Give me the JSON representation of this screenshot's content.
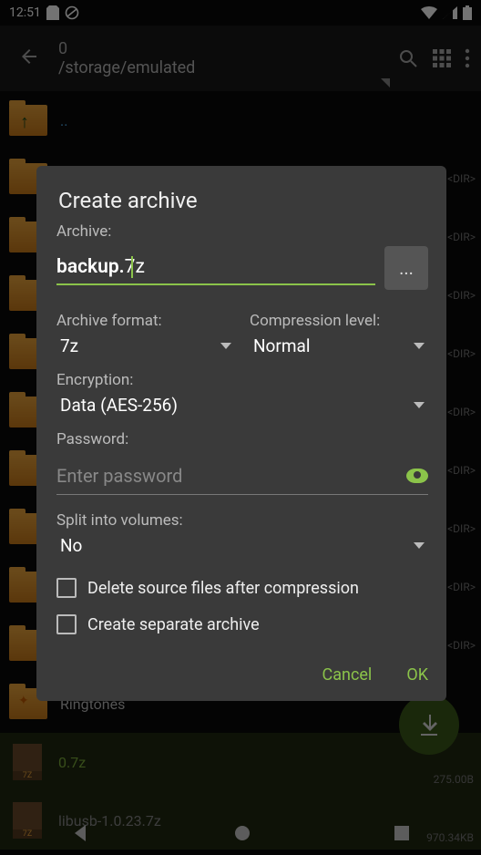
{
  "statusbar": {
    "time": "12:51"
  },
  "appbar": {
    "count": "0",
    "path": "/storage/emulated"
  },
  "fileList": {
    "upDots": "..",
    "ringtones": "Ringtones",
    "archive1": "0.7z",
    "archive1size": "275.00B",
    "archive2": "libusb-1.0.23.7z",
    "archive2size": "970.34KB",
    "dirTag": "<DIR>"
  },
  "dialog": {
    "title": "Create archive",
    "archiveLabel": "Archive:",
    "nameBase": "backup.",
    "nameExt": "7z",
    "browse": "...",
    "formatLabel": "Archive format:",
    "formatValue": "7z",
    "compLabel": "Compression level:",
    "compValue": "Normal",
    "encLabel": "Encryption:",
    "encValue": "Data (AES-256)",
    "pwdLabel": "Password:",
    "pwdPlaceholder": "Enter password",
    "splitLabel": "Split into volumes:",
    "splitValue": "No",
    "cbDelete": "Delete source files after compression",
    "cbSeparate": "Create separate archive",
    "cancel": "Cancel",
    "ok": "OK"
  }
}
